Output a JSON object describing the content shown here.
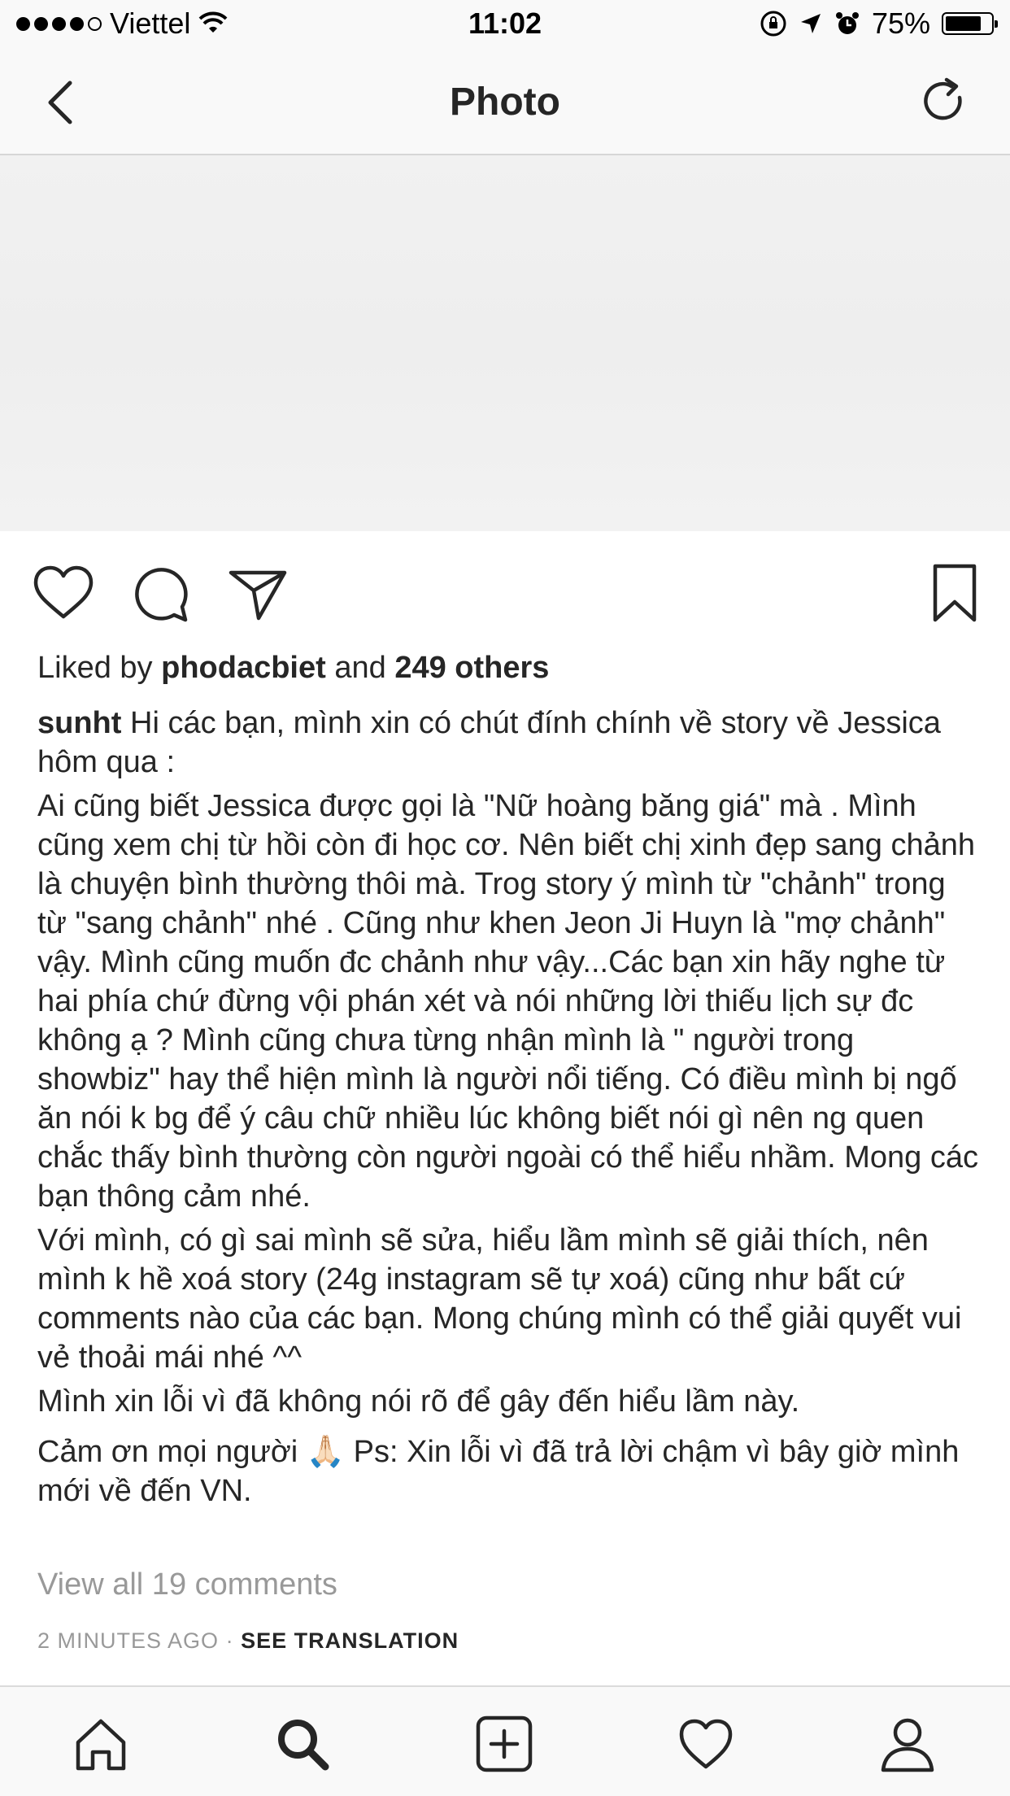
{
  "status_bar": {
    "carrier": "Viettel",
    "time": "11:02",
    "battery": "75%"
  },
  "nav": {
    "title": "Photo",
    "back_icon": "chevron-left-icon",
    "refresh_icon": "refresh-icon"
  },
  "post": {
    "likes": {
      "prefix": "Liked by",
      "user": "phodacbiet",
      "middle": "and",
      "others": "249 others"
    },
    "caption": {
      "username": "sunht",
      "first": "Hi các bạn, mình xin có chút đính chính về story về Jessica hôm qua :",
      "p2": "Ai cũng biết Jessica được gọi là \"Nữ hoàng băng giá\" mà . Mình cũng xem chị từ hồi còn đi học cơ. Nên biết chị xinh đẹp sang chảnh là chuyện bình thường thôi mà. Trog story ý mình từ \"chảnh\" trong từ \"sang chảnh\" nhé . Cũng như khen Jeon Ji Huyn là \"mợ chảnh\" vậy. Mình cũng muốn đc chảnh như vậy...Các bạn xin hãy nghe từ hai phía chứ đừng vội phán xét và nói những lời thiếu lịch sự đc không ạ ? Mình cũng chưa từng nhận mình là \" người trong showbiz\" hay thể hiện mình là người nổi tiếng. Có điều mình bị ngố ăn nói k bg để ý câu chữ nhiều lúc không biết nói gì nên ng quen chắc thấy bình thường còn người ngoài có thể hiểu nhầm. Mong các bạn thông cảm nhé.",
      "p3": "Với mình, có gì sai mình sẽ sửa, hiểu lầm mình sẽ giải thích, nên mình k hề xoá story (24g instagram sẽ tự xoá) cũng như bất cứ comments nào của các bạn. Mong chúng mình có thể giải quyết vui vẻ thoải mái nhé ^^",
      "p4": "Mình xin lỗi vì đã không nói rõ để gây đến hiểu lầm này.",
      "p5": "Cảm ơn mọi người 🙏🏻 Ps: Xin lỗi vì đã trả lời chậm vì bây giờ mình mới về đến VN."
    },
    "view_comments": "View all 19 comments",
    "timestamp": "2 MINUTES AGO",
    "separator": "·",
    "see_translation": "SEE TRANSLATION"
  },
  "tabbar": {
    "items": [
      "home-icon",
      "search-icon",
      "add-post-icon",
      "activity-heart-icon",
      "profile-icon"
    ]
  }
}
